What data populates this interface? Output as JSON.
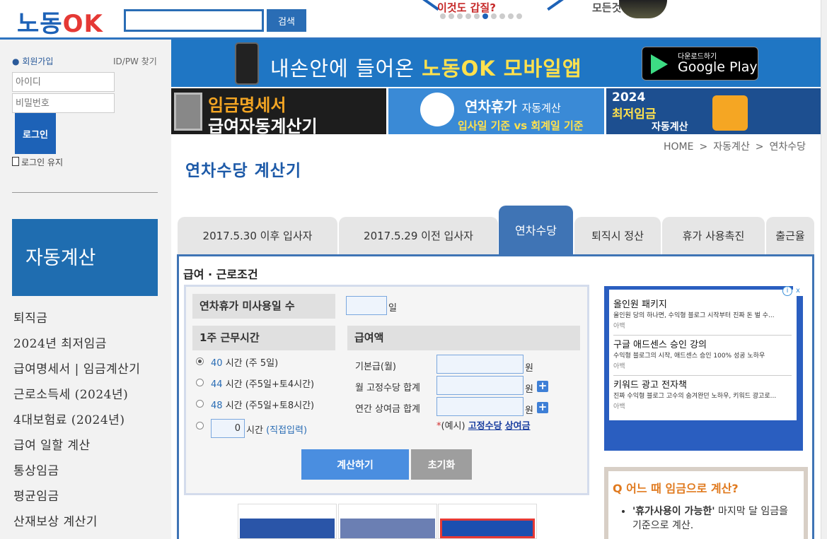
{
  "header": {
    "logo_part1": "노동",
    "logo_part2": "OK",
    "search_button": "검색",
    "promo_text": "이것도 갑질?",
    "promo2_text": "모든것"
  },
  "sidebar": {
    "signup": "회원가입",
    "find_id": "ID/PW 찾기",
    "id_placeholder": "아이디",
    "pw_placeholder": "비밀번호",
    "login_button": "로그인",
    "remember": "로그인 유지",
    "section_title": "자동계산",
    "items": [
      {
        "label": "퇴직금"
      },
      {
        "label": "2024년 최저임금"
      },
      {
        "label": "급여명세서 | 임금계산기"
      },
      {
        "label": "근로소득세 (2024년)"
      },
      {
        "label": "4대보험료 (2024년)"
      },
      {
        "label": "급여 일할 계산"
      },
      {
        "label": "통상임금"
      },
      {
        "label": "평균임금"
      },
      {
        "label": "산재보상 계산기"
      }
    ]
  },
  "banners": {
    "app_text_a": "내손안에 들어온 ",
    "app_text_b": "노동OK 모바일앱",
    "gplay_small": "다운로드하기",
    "gplay_big": "Google Play",
    "payslip_line1": "임금명세서",
    "payslip_line2": "급여자동계산기",
    "annual_title": "연차휴가",
    "annual_sub": "자동계산",
    "annual_line2": "입사일 기준 vs 회계일 기준",
    "wage_year": "2024",
    "wage_title": "최저임금",
    "wage_sub": "자동계산"
  },
  "breadcrumb": {
    "home": "HOME",
    "sep": ">",
    "level1": "자동계산",
    "level2": "연차수당"
  },
  "page_title": "연차수당 계산기",
  "tabs": [
    {
      "label": "2017.5.30 이후 입사자"
    },
    {
      "label": "2017.5.29 이전 입사자"
    },
    {
      "label": "연차수당"
    },
    {
      "label": "퇴직시 정산"
    },
    {
      "label": "휴가 사용촉진"
    },
    {
      "label": "출근율"
    }
  ],
  "form": {
    "section_label": "급여 · 근로조건",
    "unused_days_label": "연차휴가 미사용일 수",
    "unused_days_unit": "일",
    "weekly_hours_label": "1주 근무시간",
    "options": [
      {
        "hours": "40",
        "suffix": "시간 (주 5일)"
      },
      {
        "hours": "44",
        "suffix": "시간 (주5일+토4시간)"
      },
      {
        "hours": "48",
        "suffix": "시간 (주5일+토8시간)"
      }
    ],
    "custom_value": "0",
    "custom_unit": "시간",
    "custom_note": "(직접입력)",
    "pay_label": "급여액",
    "base_pay_label": "기본급(월)",
    "fixed_allowance_label": "월 고정수당 합계",
    "annual_bonus_label": "연간 상여금 합계",
    "won": "원",
    "plus": "+",
    "example_prefix": "(예시)",
    "example_star": "*",
    "example_link1": "고정수당",
    "example_link2": "상여금",
    "calc_button": "계산하기",
    "reset_button": "초기화"
  },
  "ad": {
    "info": "i",
    "close": "x",
    "items": [
      {
        "title": "올인원 패키지",
        "desc": "올인원 당의 하나면, 수익형 블로그 시작부터 진짜 돈 벌 수...",
        "src": "아백"
      },
      {
        "title": "구글 애드센스 승인 강의",
        "desc": "수익형 블로그의 시작, 애드센스 승인 100% 성공 노하우",
        "src": "아백"
      },
      {
        "title": "키워드 광고 전자책",
        "desc": "진짜 수익형 블로그 고수의 숨겨완던 노하우, 키워드 광고로...",
        "src": "아백"
      }
    ]
  },
  "faq": {
    "title": "Q 어느 때 임금으로 계산?",
    "item1_bold": "'휴가사용이 가능한'",
    "item1_rest": " 마지막 달 임금을 기준으로 계산."
  },
  "colors": {
    "brand_blue": "#1d62b7",
    "tab_active": "#3f74b5",
    "calc_button": "#4a8ee0",
    "faq_accent": "#e07a1f"
  }
}
